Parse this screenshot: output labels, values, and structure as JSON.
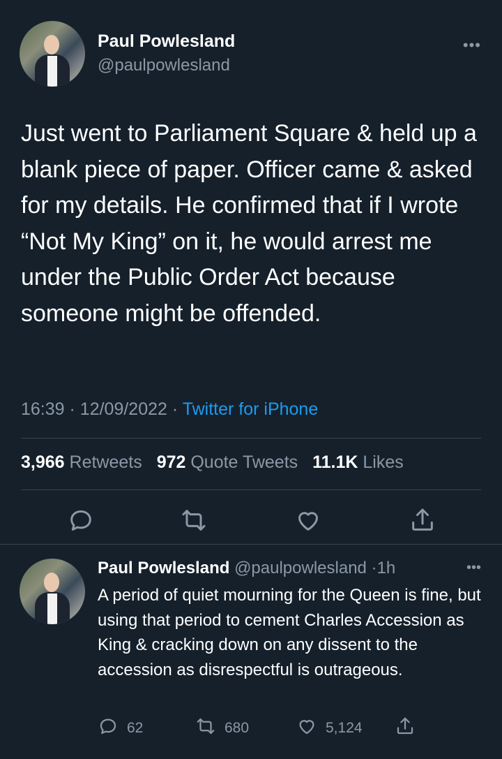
{
  "main_tweet": {
    "author_name": "Paul Powlesland",
    "author_handle": "@paulpowlesland",
    "text": "Just went to Parliament Square & held up a blank piece of paper. Officer came & asked for my details. He confirmed that if I wrote “Not My King” on it, he would arrest me under the Public Order Act because someone might be offended.",
    "time": "16:39",
    "date": "12/09/2022",
    "source": "Twitter for iPhone",
    "stats": {
      "retweets_count": "3,966",
      "retweets_label": "Retweets",
      "quotes_count": "972",
      "quotes_label": "Quote Tweets",
      "likes_count": "11.1K",
      "likes_label": "Likes"
    }
  },
  "reply": {
    "author_name": "Paul Powlesland",
    "author_handle": "@paulpowlesland",
    "age": "1h",
    "text": "A period of quiet mourning for the Queen is fine, but using that period to cement Charles Accession as King & cracking down on any dissent to the accession as disrespectful is outrageous.",
    "replies": "62",
    "retweets": "680",
    "likes": "5,124"
  },
  "colors": {
    "background": "#15202b",
    "muted": "#8b98a5",
    "accent": "#1d9bf0",
    "divider": "#38444d"
  },
  "icons": [
    "more-icon",
    "reply-icon",
    "retweet-icon",
    "like-icon",
    "share-icon"
  ]
}
